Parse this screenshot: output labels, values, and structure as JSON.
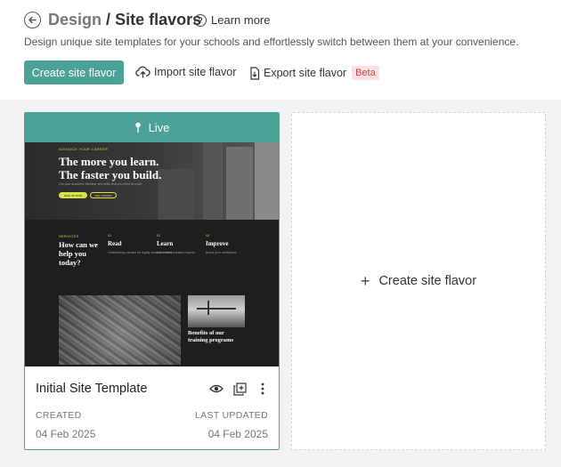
{
  "header": {
    "breadcrumb_parent": "Design",
    "separator": "/",
    "title": "Site flavors",
    "help_label": "Learn more",
    "subtitle": "Design unique site templates for your schools and effortlessly switch between them at your convenience."
  },
  "toolbar": {
    "create_label": "Create site flavor",
    "import_label": "Import site flavor",
    "export_label": "Export site flavor",
    "beta_badge": "Beta"
  },
  "flavor_card": {
    "status_label": "Live",
    "name": "Initial Site Template",
    "created_label": "CREATED",
    "created_value": "04 Feb 2025",
    "updated_label": "LAST UPDATED",
    "updated_value": "04 Feb 2025",
    "preview": {
      "hero_kicker": "ADVANCE YOUR CAREER",
      "hero_title_line1": "The more you learn.",
      "hero_title_line2": "The faster you build.",
      "hero_sub": "Get your Academy Member and skills that you need to excel.",
      "hero_btn_primary": "SIGN UP NOW",
      "hero_btn_secondary": "SEE OFFERS",
      "section_kicker": "SERVICES",
      "section_title": "How can we help you today?",
      "col1_num": "01",
      "col1_title": "Read",
      "col1_text": "Outstanding courses for highly curated content.",
      "col2_num": "02",
      "col2_title": "Learn",
      "col2_text": "Learn from industry experts.",
      "col3_num": "03",
      "col3_title": "Improve",
      "col3_text": "Boost your confidence.",
      "benefits_title": "Benefits of our training programs"
    }
  },
  "create_card": {
    "label": "Create site flavor"
  },
  "colors": {
    "accent": "#4aa396",
    "badge_bg": "#fbe1e1",
    "badge_text": "#c64a4a",
    "content_bg": "#f2f2f2"
  },
  "icons": {
    "back": "arrow-left-circle-icon",
    "help": "question-circle-icon",
    "import": "cloud-upload-icon",
    "export": "file-export-icon",
    "live": "pin-icon",
    "view": "eye-icon",
    "duplicate": "copy-add-icon",
    "more": "kebab-menu-icon",
    "plus": "plus-icon"
  }
}
